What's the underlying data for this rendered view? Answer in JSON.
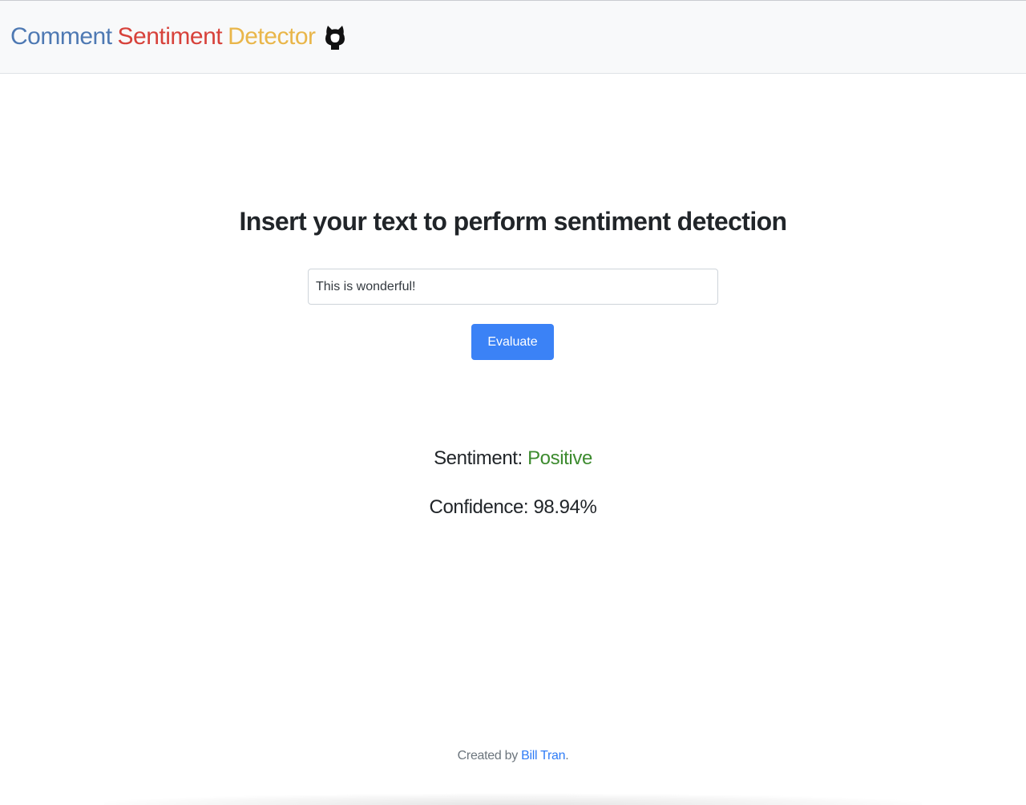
{
  "navbar": {
    "brand": {
      "word1": "Comment",
      "word2": "Sentiment",
      "word3": "Detector",
      "colors": [
        "#4e79b3",
        "#d7423b",
        "#e9b64a"
      ]
    },
    "github_icon": "github-icon"
  },
  "main": {
    "title": "Insert your text to perform sentiment detection",
    "input": {
      "value": "This is wonderful!",
      "placeholder": ""
    },
    "evaluate_label": "Evaluate",
    "accent_color": "#3b82f6"
  },
  "result": {
    "sentiment_label": "Sentiment:",
    "sentiment_value": "Positive",
    "sentiment_color": "#3d8b2f",
    "confidence_label": "Confidence:",
    "confidence_value": "98.94%"
  },
  "footer": {
    "prefix": "Created by",
    "author_link": "Bill Tran",
    "suffix": "."
  }
}
